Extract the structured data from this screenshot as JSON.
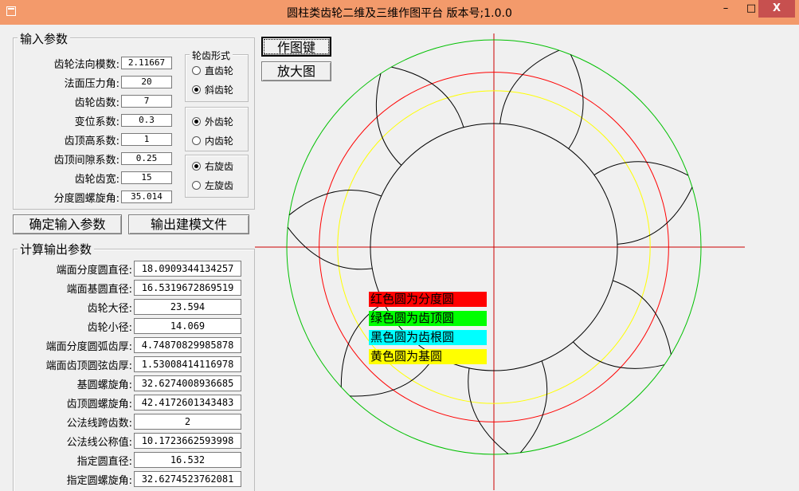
{
  "window": {
    "title": "圆柱类齿轮二维及三维作图平台 版本号;1.0.0",
    "minimize_label": "–",
    "maximize_label": "□",
    "close_label": "X"
  },
  "input_group": {
    "title": "输入参数",
    "fields": [
      {
        "label": "齿轮法向模数:",
        "value": "2.11667"
      },
      {
        "label": "法面压力角:",
        "value": "20"
      },
      {
        "label": "齿轮齿数:",
        "value": "7"
      },
      {
        "label": "变位系数:",
        "value": "0.3"
      },
      {
        "label": "齿顶高系数:",
        "value": "1"
      },
      {
        "label": "齿顶间隙系数:",
        "value": "0.25"
      },
      {
        "label": "齿轮齿宽:",
        "value": "15"
      },
      {
        "label": "分度圆螺旋角:",
        "value": "35.014"
      }
    ]
  },
  "tooth_form": {
    "title": "轮齿形式",
    "options": [
      {
        "label": "直齿轮",
        "checked": false
      },
      {
        "label": "斜齿轮",
        "checked": true
      }
    ]
  },
  "gear_type": {
    "options": [
      {
        "label": "外齿轮",
        "checked": true
      },
      {
        "label": "内齿轮",
        "checked": false
      }
    ]
  },
  "helix_dir": {
    "options": [
      {
        "label": "右旋齿",
        "checked": true
      },
      {
        "label": "左旋齿",
        "checked": false
      }
    ]
  },
  "buttons": {
    "confirm": "确定输入参数",
    "export": "输出建模文件",
    "draw": "作图键",
    "zoom": "放大图"
  },
  "output_group": {
    "title": "计算输出参数",
    "fields": [
      {
        "label": "端面分度圆直径:",
        "value": "18.0909344134257"
      },
      {
        "label": "端面基圆直径:",
        "value": "16.5319672869519"
      },
      {
        "label": "齿轮大径:",
        "value": "23.594"
      },
      {
        "label": "齿轮小径:",
        "value": "14.069"
      },
      {
        "label": "端面分度圆弧齿厚:",
        "value": "4.74870829985878"
      },
      {
        "label": "端面齿顶圆弦齿厚:",
        "value": "1.53008414116978"
      },
      {
        "label": "基圆螺旋角:",
        "value": "32.6274008936685"
      },
      {
        "label": "齿顶圆螺旋角:",
        "value": "42.4172601343483"
      },
      {
        "label": "公法线跨齿数:",
        "value": "2"
      },
      {
        "label": "公法线公称值:",
        "value": "10.1723662593998"
      },
      {
        "label": "指定圆直径:",
        "value": "16.532"
      },
      {
        "label": "指定圆螺旋角:",
        "value": "32.6274523762081"
      }
    ]
  },
  "legend": [
    {
      "label": "红色圆为分度圆",
      "color": "#ff0000"
    },
    {
      "label": "绿色圆为齿顶圆",
      "color": "#00ff00"
    },
    {
      "label": "黑色圆为齿根圆",
      "color": "#00ffff"
    },
    {
      "label": "黄色圆为基圆",
      "color": "#ffff00"
    }
  ],
  "drawing": {
    "tooth_count": 7,
    "addendum_diameter": 23.594,
    "pitch_diameter": 18.0909344134257,
    "base_diameter": 16.5319672869519,
    "root_diameter": 14.069,
    "colors": {
      "addendum": "#00c000",
      "pitch": "#ff0000",
      "base": "#ffff00",
      "root": "#000000",
      "axis": "#cc0000",
      "tooth": "#000000"
    }
  }
}
